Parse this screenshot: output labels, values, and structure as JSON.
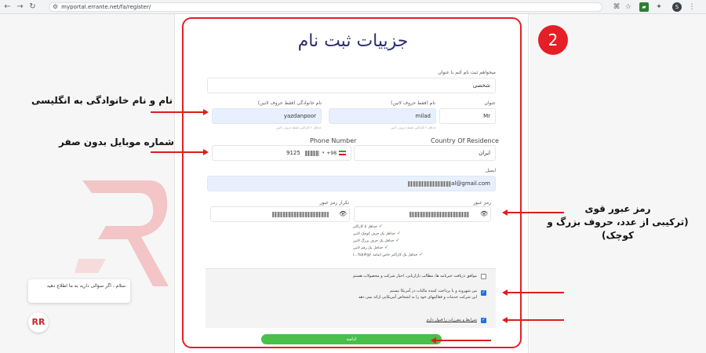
{
  "browser": {
    "url": "myportal.errante.net/fa/register/",
    "back": "←",
    "forward": "→",
    "reload": "↻",
    "tune": "⚙",
    "profile_initial": "S"
  },
  "colors": {
    "accent_red": "#e41f26",
    "continue_green": "#48c04a",
    "title_navy": "#2b2f6c"
  },
  "step_number": "2",
  "form": {
    "title": "جزییات ثبت نام",
    "address_label": "میخواهم ثبت نام کنم با عنوان",
    "address_value": "شخصی",
    "title_label": "عنوان",
    "title_value": "Mr",
    "first_name_label": "نام (فقط حروف لاتین)",
    "first_name_value": "milad",
    "first_name_hint": "حداقل ۲ کاراکتر، فقط حروف لاتین",
    "last_name_label": "نام خانوادگی (فقط حروف لاتین)",
    "last_name_value": "yazdanpoor",
    "last_name_hint": "حداقل ۲ کاراکتر، فقط حروف لاتین",
    "country_label": "Country Of Residence",
    "country_value": "ایران",
    "phone_label": "Phone Number",
    "phone_code": "+98",
    "phone_value": "9125",
    "email_label": "ایمیل",
    "email_value": "al@gmail.com",
    "password_label": "رمز عبور",
    "confirm_password_label": "تکرار رمز عبور",
    "password_rules": [
      "حداقل ۸ کاراکتر",
      "حداقل یک حرف کوچک لاتین",
      "حداقل یک حرف بزرگ لاتین",
      "حداقل یک رقم لاتین",
      "حداقل یک کاراکتر خاص (مانند !@#$%...)"
    ],
    "consent_marketing": "موافق دریافت خبرنامه ها، مطالب بازاریابی، اخبار شرکت و محصولات هستم",
    "consent_us_line1": "من شهروند و یا پرداخت کننده مالیات در آمریکا نیستم",
    "consent_us_line2": "این شرکت خدمات و فعالیتهای خود را به اشخاص آمریکایی ارائه نمی دهد",
    "consent_terms": "شرایط و مقررات را قبول دارم",
    "continue_label": "ادامه"
  },
  "chat": {
    "text": "سلام ، اگر سوالی دارید به ما اطلاع دهید"
  },
  "annotations": {
    "latin_name": "نام و نام خانوادگی به انگلیسی",
    "phone_no_zero": "شماره موبایل بدون صفر",
    "strong_password_line1": "رمز عبور قوی",
    "strong_password_line2": "(ترکیبی از عدد، حروف بزرگ و کوچک)"
  }
}
